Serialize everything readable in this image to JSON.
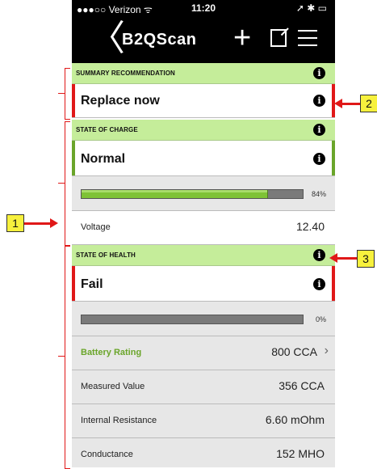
{
  "status_bar": {
    "carrier": "●●●○○ Verizon ᯤ",
    "time": "11:20",
    "right": "➚ ✱ ▭"
  },
  "navbar": {
    "back_glyph": "〈",
    "brand": "B2QScan",
    "plus_glyph": "+"
  },
  "summary": {
    "header": "SUMMARY RECOMMENDATION",
    "value": "Replace now",
    "edge_color": "#e01818"
  },
  "charge": {
    "header": "STATE OF CHARGE",
    "value": "Normal",
    "edge_color": "#6aa52a",
    "progress_fraction": 0.84,
    "progress_label": "84%",
    "voltage_label": "Voltage",
    "voltage_value": "12.40"
  },
  "health": {
    "header": "STATE OF HEALTH",
    "value": "Fail",
    "edge_color": "#e01818",
    "progress_fraction": 0.0,
    "progress_label": "0%",
    "rows": [
      {
        "label": "Battery Rating",
        "value": "800 CCA"
      },
      {
        "label": "Measured Value",
        "value": "356 CCA"
      },
      {
        "label": "Internal Resistance",
        "value": "6.60 mOhm"
      },
      {
        "label": "Conductance",
        "value": "152 MHO"
      }
    ]
  },
  "info_glyph": "i",
  "chevron_glyph": "›",
  "callouts": {
    "c1": "1",
    "c2": "2",
    "c3": "3"
  }
}
